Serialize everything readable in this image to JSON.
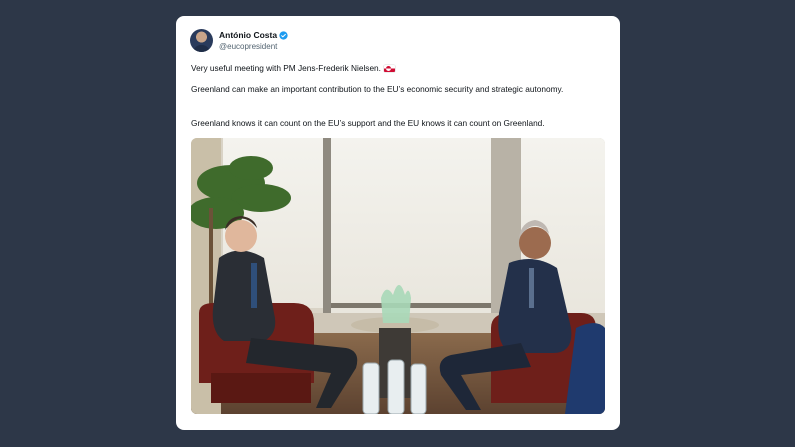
{
  "tweet": {
    "author": {
      "display_name": "António Costa",
      "handle": "@eucopresident",
      "verified": true
    },
    "paragraphs": [
      "Very useful meeting with PM Jens-Frederik Nielsen.",
      "Greenland can make an important contribution to the EU’s economic security and strategic autonomy.",
      "Greenland knows it can count on the EU’s support and the EU knows it can count on Greenland."
    ],
    "flag_icon": "greenland-flag-icon",
    "photo_icon": "meeting-photo"
  },
  "colors": {
    "background": "#2d3748",
    "card": "#ffffff",
    "verified": "#1d9bf0",
    "text": "#0f1419",
    "muted": "#536471"
  }
}
